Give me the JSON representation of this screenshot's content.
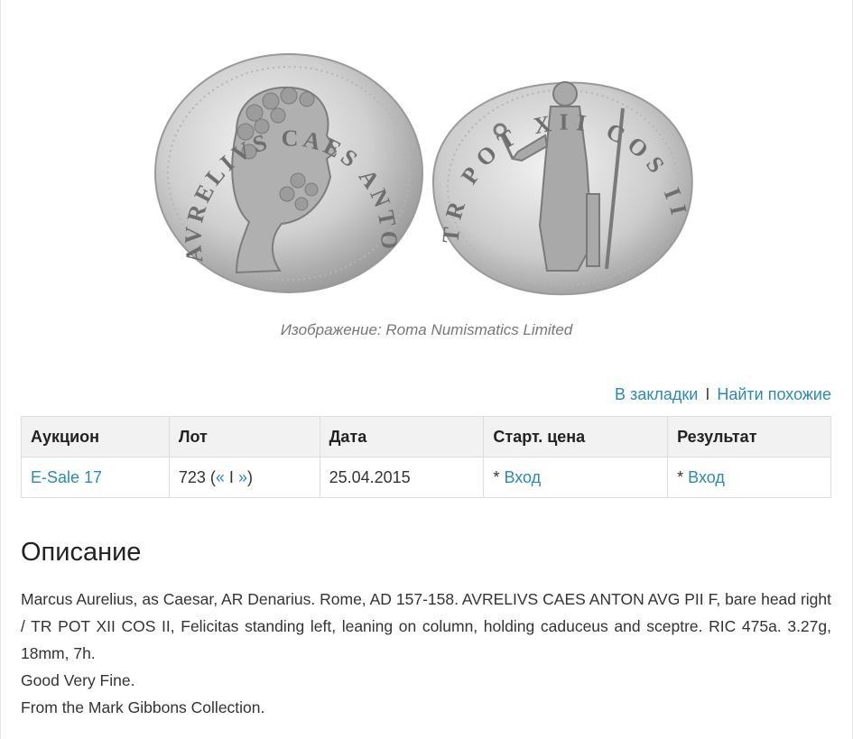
{
  "image_caption": "Изображение: Roma Numismatics Limited",
  "coin": {
    "obverse_legend": "AVRELIVS CAES ANTON AVG PII F",
    "reverse_legend": "TR POT XII COS II"
  },
  "actions": {
    "bookmark": "В закладки",
    "separator": "I",
    "find_similar": "Найти похожие"
  },
  "table": {
    "headers": [
      "Аукцион",
      "Лот",
      "Дата",
      "Старт. цена",
      "Результат"
    ],
    "row": {
      "auction": "E-Sale 17",
      "lot_number": "723",
      "lot_prev": "«",
      "lot_sep": "I",
      "lot_next": "»",
      "date": "25.04.2015",
      "start_price_prefix": "*",
      "start_price_link": "Вход",
      "result_prefix": "*",
      "result_link": "Вход"
    }
  },
  "description": {
    "title": "Описание",
    "paragraphs": [
      "Marcus Aurelius, as Caesar, AR Denarius. Rome, AD 157-158. AVRELIVS CAES ANTON AVG PII F, bare head right / TR POT XII COS II, Felicitas standing left, leaning on column, holding caduceus and sceptre. RIC 475a. 3.27g, 18mm, 7h.",
      "Good Very Fine.",
      "From the Mark Gibbons Collection."
    ]
  }
}
